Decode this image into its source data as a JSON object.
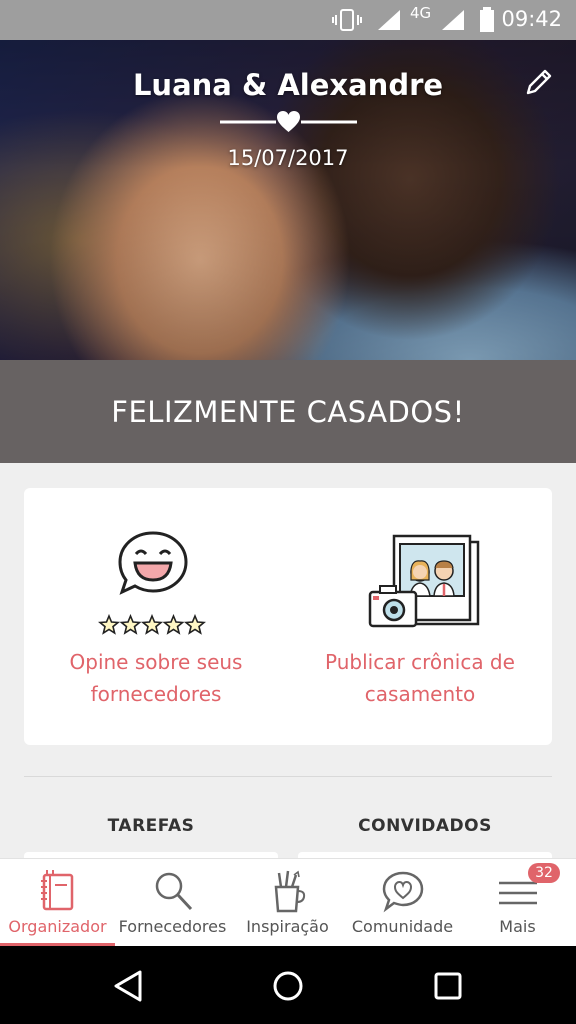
{
  "status_bar": {
    "network": "4G",
    "time": "09:42"
  },
  "header": {
    "couple": "Luana & Alexandre",
    "date": "15/07/2017"
  },
  "banner": {
    "text": "FELIZMENTE CASADOS!"
  },
  "actions": [
    {
      "line1": "Opine sobre seus",
      "line2": "fornecedores"
    },
    {
      "line1": "Publicar crônica de",
      "line2": "casamento"
    }
  ],
  "sections": {
    "left": "TAREFAS",
    "right": "CONVIDADOS"
  },
  "nav": {
    "items": [
      {
        "label": "Organizador",
        "icon": "notebook-icon"
      },
      {
        "label": "Fornecedores",
        "icon": "search-icon"
      },
      {
        "label": "Inspiração",
        "icon": "pencil-cup-icon"
      },
      {
        "label": "Comunidade",
        "icon": "heart-chat-icon"
      },
      {
        "label": "Mais",
        "icon": "menu-icon"
      }
    ],
    "badge": "32",
    "active": "Organizador"
  },
  "colors": {
    "accent": "#e0646a",
    "banner": "#676262"
  }
}
